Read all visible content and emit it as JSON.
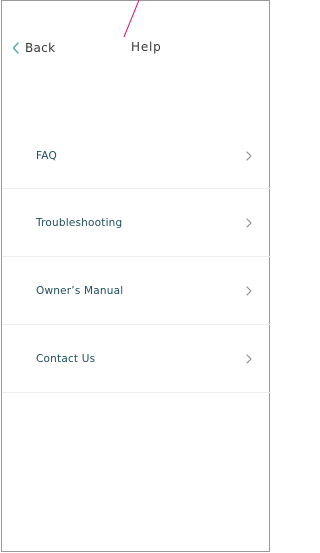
{
  "header": {
    "back_label": "Back",
    "title": "Help"
  },
  "menu": {
    "items": [
      {
        "label": "FAQ"
      },
      {
        "label": "Troubleshooting"
      },
      {
        "label": "Owner’s Manual"
      },
      {
        "label": "Contact Us"
      }
    ]
  },
  "colors": {
    "accent": "#4bb3a6",
    "item_text": "#1f4f5a",
    "chevron": "#8a8a8a",
    "annotation_line": "#d4146e",
    "frame_border": "#9a9a9a",
    "divider": "#ececec"
  },
  "icons": {
    "back": "chevron-left-icon",
    "row": "chevron-right-icon"
  }
}
